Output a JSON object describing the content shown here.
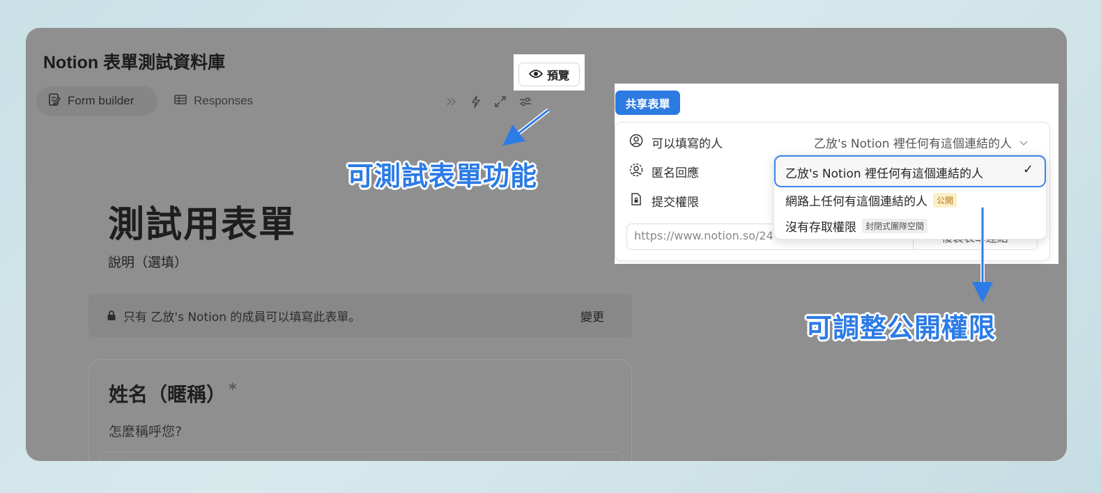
{
  "database_title": "Notion 表單測試資料庫",
  "tabs": [
    {
      "label": "Form builder",
      "icon": "form-edit-icon",
      "active": true
    },
    {
      "label": "Responses",
      "icon": "table-icon",
      "active": false
    }
  ],
  "toolbar": {
    "icons": [
      "double-chevron-icon",
      "lightning-icon",
      "expand-icon",
      "sliders-icon"
    ],
    "preview_label": "預覽"
  },
  "form": {
    "title": "測試用表單",
    "description": "說明（選填）",
    "notice": "只有 乙放's Notion 的成員可以填寫此表單。",
    "notice_action": "變更",
    "question": {
      "title": "姓名（暱稱）",
      "required_mark": "*",
      "help": "怎麼稱呼您?"
    }
  },
  "share": {
    "button_label": "共享表單",
    "rows": [
      {
        "label": "可以填寫的人",
        "icon": "person-circle-icon"
      },
      {
        "label": "匿名回應",
        "icon": "anonymous-icon"
      },
      {
        "label": "提交權限",
        "icon": "file-lock-icon"
      }
    ],
    "who_can_fill_value": "乙放's Notion 裡任何有這個連結的人",
    "link_url": "https://www.notion.so/24",
    "copy_label": "複製表單連結",
    "dropdown_options": [
      {
        "label": "乙放's Notion 裡任何有這個連結的人",
        "selected": true,
        "tag": ""
      },
      {
        "label": "網路上任何有這個連結的人",
        "selected": false,
        "tag": "公開"
      },
      {
        "label": "沒有存取權限",
        "selected": false,
        "tag": "封閉式團隊空間"
      }
    ],
    "check_mark": "✓"
  },
  "annotations": {
    "preview_note": "可測試表單功能",
    "permission_note": "可調整公開權限"
  },
  "colors": {
    "accent": "#2d7be0",
    "annotation": "#2c7be6",
    "overlay": "#8f8f8f"
  }
}
